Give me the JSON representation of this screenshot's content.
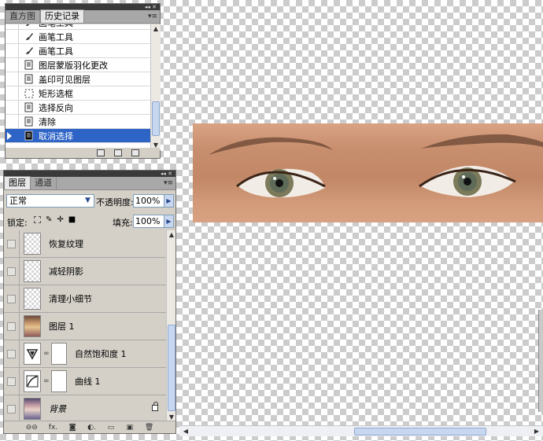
{
  "history_panel": {
    "tabs": [
      "直方图",
      "历史记录"
    ],
    "active_tab": 1,
    "collapse": "◂◂ ✕",
    "menu": "▾≡",
    "items": [
      {
        "label": "画笔工具",
        "icon": "brush-icon"
      },
      {
        "label": "画笔工具",
        "icon": "brush-icon"
      },
      {
        "label": "画笔工具",
        "icon": "brush-icon"
      },
      {
        "label": "图层蒙版羽化更改",
        "icon": "document-icon"
      },
      {
        "label": "盖印可见图层",
        "icon": "document-icon"
      },
      {
        "label": "矩形选框",
        "icon": "marquee-icon"
      },
      {
        "label": "选择反向",
        "icon": "document-icon"
      },
      {
        "label": "清除",
        "icon": "document-icon"
      },
      {
        "label": "取消选择",
        "icon": "document-icon",
        "selected": true
      }
    ],
    "scroll_thumb_fraction": 0.45
  },
  "layers_panel": {
    "tabs": [
      "图层",
      "通道"
    ],
    "active_tab": 0,
    "collapse": "◂◂ ✕",
    "menu": "▾≡",
    "blend_mode": "正常",
    "opacity_label": "不透明度:",
    "opacity_value": "100%",
    "lock_label": "锁定:",
    "fill_label": "填充:",
    "fill_value": "100%",
    "layers": [
      {
        "name": "恢复纹理",
        "thumb": "transparent"
      },
      {
        "name": "减轻阴影",
        "thumb": "transparent"
      },
      {
        "name": "清理小细节",
        "thumb": "transparent"
      },
      {
        "name": "图层 1",
        "thumb": "photo"
      },
      {
        "name": "自然饱和度 1",
        "thumb": "vibrance-icon",
        "mask": true
      },
      {
        "name": "曲线 1",
        "thumb": "curves-icon",
        "mask": true
      },
      {
        "name": "背景",
        "thumb": "photo2",
        "italic": true,
        "locked": true
      }
    ],
    "footer_icons": [
      "link-icon",
      "fx-icon",
      "mask-icon",
      "adjustment-icon",
      "group-icon",
      "new-layer-icon",
      "trash-icon"
    ],
    "footer_glyphs": [
      "⊖⊖",
      "fx.",
      "◙",
      "◐.",
      "▭",
      "▣",
      "🗑"
    ]
  },
  "colors": {
    "selection": "#2f64c7",
    "panel_bg": "#d4d0c8",
    "skin": "#c88f6f"
  }
}
